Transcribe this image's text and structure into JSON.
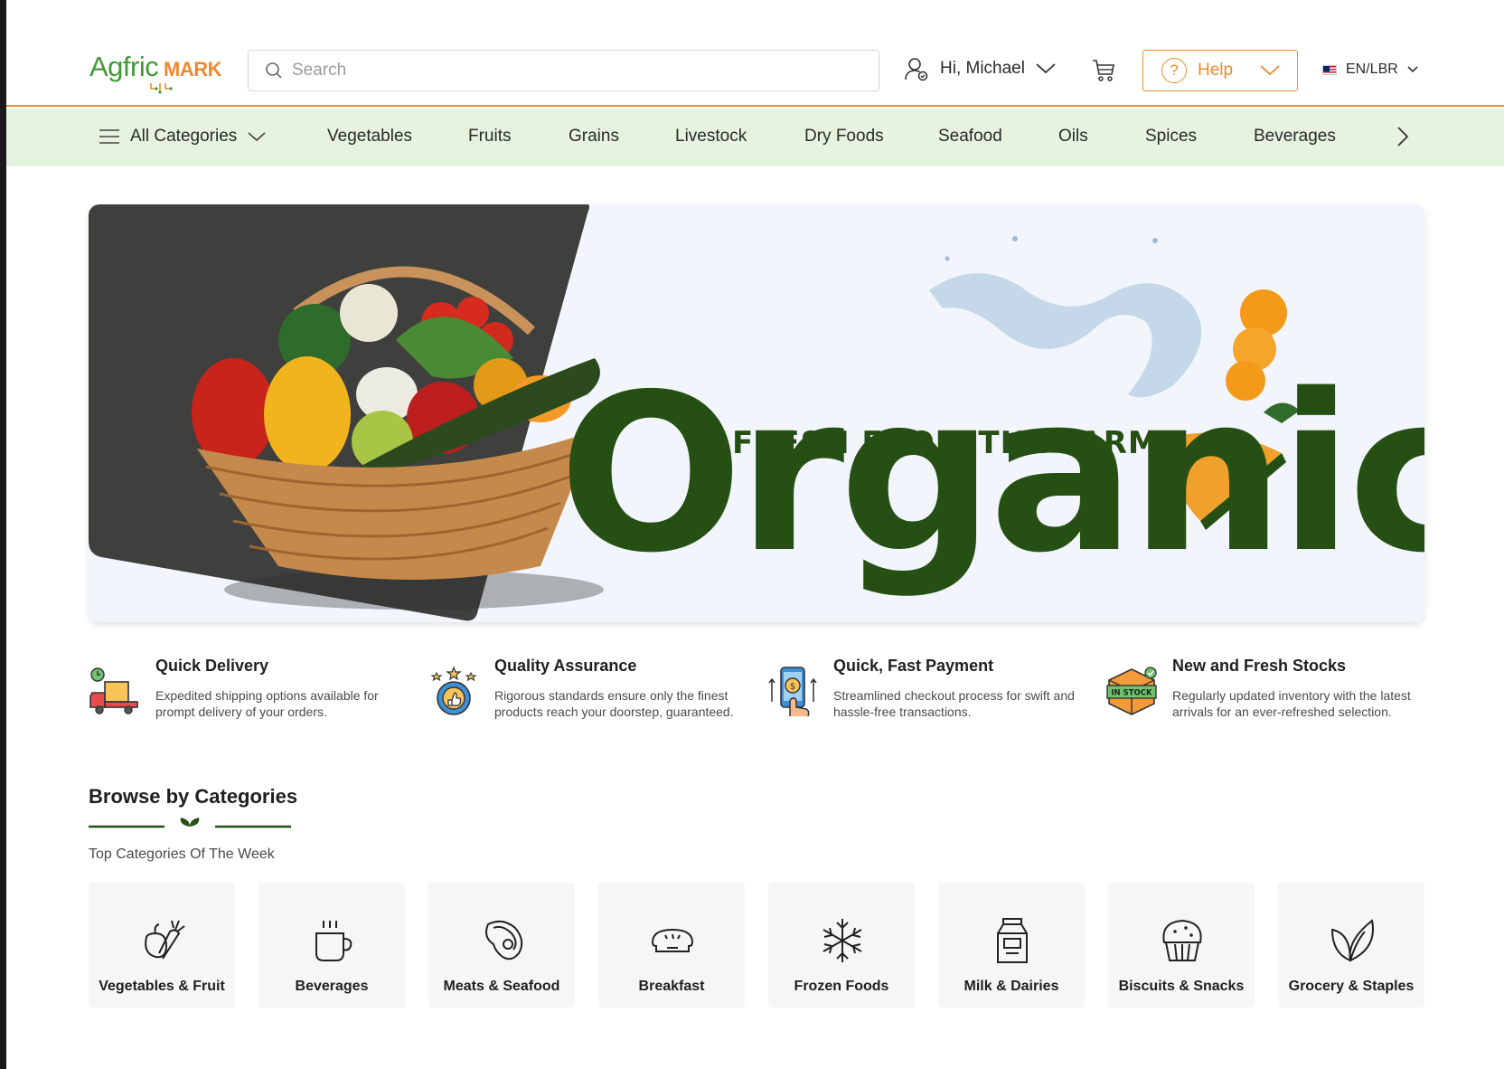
{
  "header": {
    "logo": {
      "part1": "Agfric",
      "part2": "MARK"
    },
    "search": {
      "placeholder": "Search",
      "value": ""
    },
    "user": {
      "greeting": "Hi, Michael"
    },
    "help": {
      "label": "Help"
    },
    "language": {
      "label": "EN/LBR"
    }
  },
  "category_nav": {
    "all_label": "All Categories",
    "items": [
      "Vegetables",
      "Fruits",
      "Grains",
      "Livestock",
      "Dry Foods",
      "Seafood",
      "Oils",
      "Spices",
      "Beverages"
    ]
  },
  "hero": {
    "tagline": "FRESH FROM THE FARM",
    "headline": "Organic"
  },
  "features": [
    {
      "title": "Quick Delivery",
      "description": "Expedited shipping options available for prompt delivery of your orders.",
      "icon": "delivery-truck-icon"
    },
    {
      "title": "Quality Assurance",
      "description": "Rigorous standards ensure only the finest products reach your doorstep, guaranteed.",
      "icon": "quality-badge-icon"
    },
    {
      "title": "Quick, Fast Payment",
      "description": "Streamlined checkout process for swift and hassle-free transactions.",
      "icon": "mobile-payment-icon"
    },
    {
      "title": "New and Fresh Stocks",
      "description": "Regularly updated inventory with the latest arrivals for an ever-refreshed selection.",
      "icon": "in-stock-box-icon",
      "badge": "IN STOCK"
    }
  ],
  "browse": {
    "title": "Browse by Categories",
    "subtitle": "Top Categories Of The Week",
    "categories": [
      {
        "label": "Vegetables & Fruit",
        "icon": "vegetables-fruit-icon"
      },
      {
        "label": "Beverages",
        "icon": "coffee-cup-icon"
      },
      {
        "label": "Meats & Seafood",
        "icon": "steak-icon"
      },
      {
        "label": "Breakfast",
        "icon": "bread-icon"
      },
      {
        "label": "Frozen Foods",
        "icon": "snowflake-icon"
      },
      {
        "label": "Milk & Dairies",
        "icon": "milk-carton-icon"
      },
      {
        "label": "Biscuits & Snacks",
        "icon": "muffin-icon"
      },
      {
        "label": "Grocery & Staples",
        "icon": "leaves-icon"
      }
    ]
  },
  "colors": {
    "brand_green": "#3e9a34",
    "brand_orange": "#ee8a2e",
    "dark_green": "#254f13",
    "nav_bg": "#e6f4df",
    "hero_bg": "#f2f6fc"
  }
}
